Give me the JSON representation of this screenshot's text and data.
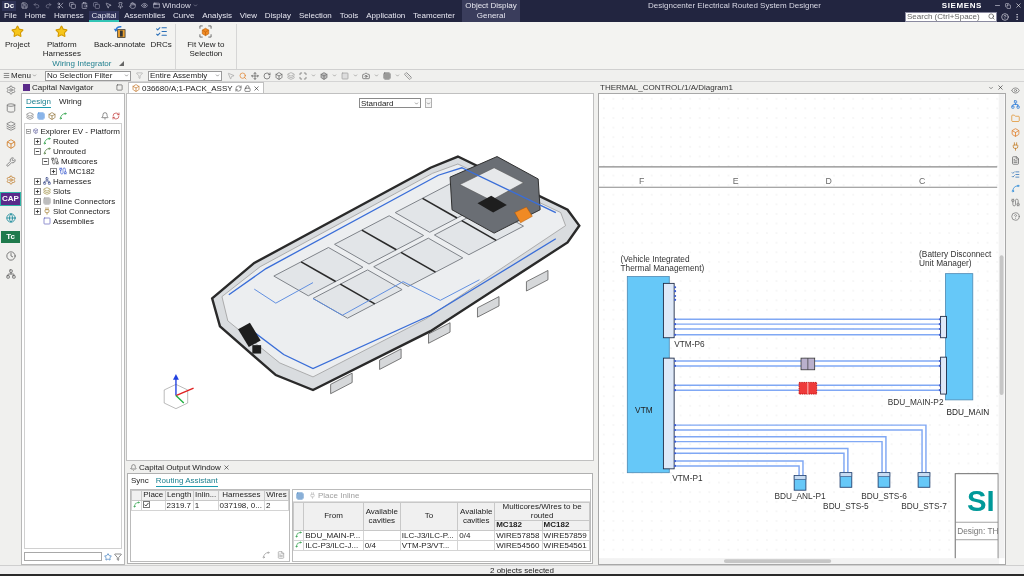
{
  "title_bar": {
    "logo": "Dc",
    "window_menu": "Window",
    "context_group": "Object Display",
    "title": "Designcenter Electrical Routed System Designer",
    "brand": "SIEMENS"
  },
  "menu_tabs": [
    {
      "label": "File",
      "selected": false
    },
    {
      "label": "Home",
      "selected": false
    },
    {
      "label": "Harness",
      "selected": false
    },
    {
      "label": "Capital",
      "selected": true
    },
    {
      "label": "Assemblies",
      "selected": false
    },
    {
      "label": "Curve",
      "selected": false
    },
    {
      "label": "Analysis",
      "selected": false
    },
    {
      "label": "View",
      "selected": false
    },
    {
      "label": "Display",
      "selected": false
    },
    {
      "label": "Selection",
      "selected": false
    },
    {
      "label": "Tools",
      "selected": false
    },
    {
      "label": "Application",
      "selected": false
    },
    {
      "label": "Teamcenter",
      "selected": false
    }
  ],
  "context_tab": {
    "label": "General",
    "selected": false
  },
  "search": {
    "placeholder": "Search (Ctrl+Space)"
  },
  "ribbon": {
    "groups": [
      {
        "label": "Wiring Integrator",
        "buttons": [
          "Project",
          "Platform Harnesses",
          "Back-annotate",
          "DRCs"
        ]
      },
      {
        "buttons": [
          "Fit View to Selection"
        ]
      }
    ]
  },
  "toolbar": {
    "menu": "Menu",
    "selection_filter": "No Selection Filter",
    "assembly_filter": "Entire Assembly"
  },
  "resource_bar": {
    "tiles": [
      {
        "label": "CAP",
        "color": "#5a2a8a",
        "selected": true
      },
      {
        "label": "Tc",
        "color": "#1f7a4c",
        "selected": false
      }
    ]
  },
  "navigator": {
    "title": "Capital Navigator",
    "tabs": [
      {
        "label": "Design",
        "selected": true
      },
      {
        "label": "Wiring",
        "selected": false
      }
    ],
    "tree": [
      {
        "label": "Explorer EV - Platform",
        "expanded": true,
        "children": [
          {
            "label": "Routed",
            "expanded": false
          },
          {
            "label": "Unrouted",
            "expanded": true,
            "children": [
              {
                "label": "Multicores",
                "expanded": true,
                "children": [
                  {
                    "label": "MC182",
                    "expanded": false
                  }
                ]
              }
            ]
          },
          {
            "label": "Harnesses",
            "expanded": false
          },
          {
            "label": "Slots",
            "expanded": false
          },
          {
            "label": "Inline Connectors",
            "expanded": false
          },
          {
            "label": "Slot Connectors",
            "expanded": false
          },
          {
            "label": "Assemblies"
          }
        ]
      }
    ]
  },
  "viewport": {
    "tab": "036680/A;1-PACK_ASSY",
    "view_style": "Standard"
  },
  "output_window": {
    "title": "Capital Output Window",
    "tabs": [
      {
        "label": "Sync",
        "selected": false
      },
      {
        "label": "Routing Assistant",
        "selected": true
      }
    ],
    "paths_table": {
      "columns": [
        "Place",
        "Length",
        "Inlin...",
        "Harnesses",
        "Wires"
      ],
      "rows": [
        {
          "checked": true,
          "cells": [
            "",
            "2319.7",
            "1",
            "037198, 0...",
            "2"
          ]
        }
      ]
    },
    "routing": {
      "action": {
        "label": "Place Inline",
        "disabled": true
      },
      "group_header": "Multicores/Wires to be routed",
      "columns": [
        "From",
        "Available cavities",
        "To",
        "Available cavities",
        "MC182",
        "MC182"
      ],
      "rows": [
        {
          "cells": [
            "BDU_MAIN-P...",
            "",
            "ILC-J3/ILC-P...",
            "0/4",
            "WIRE57858",
            "WIRE57859"
          ]
        },
        {
          "cells": [
            "ILC-P3/ILC-J...",
            "0/4",
            "VTM-P3/VT...",
            "",
            "WIRE54560",
            "WIRE54561"
          ]
        }
      ]
    }
  },
  "diagram": {
    "tab": "THERMAL_CONTROL/1/A/Diagram1",
    "zones": [
      "F",
      "E",
      "D",
      "C"
    ],
    "devices": [
      {
        "name": "(Vehicle Integrated Thermal Management)",
        "ref": "VTM",
        "connectors": [
          "VTM-P6",
          "VTM-P1"
        ]
      },
      {
        "name": "(Battery Disconnect Unit Manager)",
        "ref": "BDU_MAIN",
        "connectors": [
          "BDU_MAIN-P2"
        ]
      }
    ],
    "inline_connectors": [
      {
        "selected": false
      },
      {
        "selected": true
      }
    ],
    "end_connectors": [
      "BDU_ANL-P1",
      "BDU_STS-5",
      "BDU_STS-6",
      "BDU_STS-7"
    ],
    "title_block": {
      "logo": "SI",
      "design": "Design: TH"
    }
  },
  "status_bar": {
    "message": "2 objects selected"
  }
}
